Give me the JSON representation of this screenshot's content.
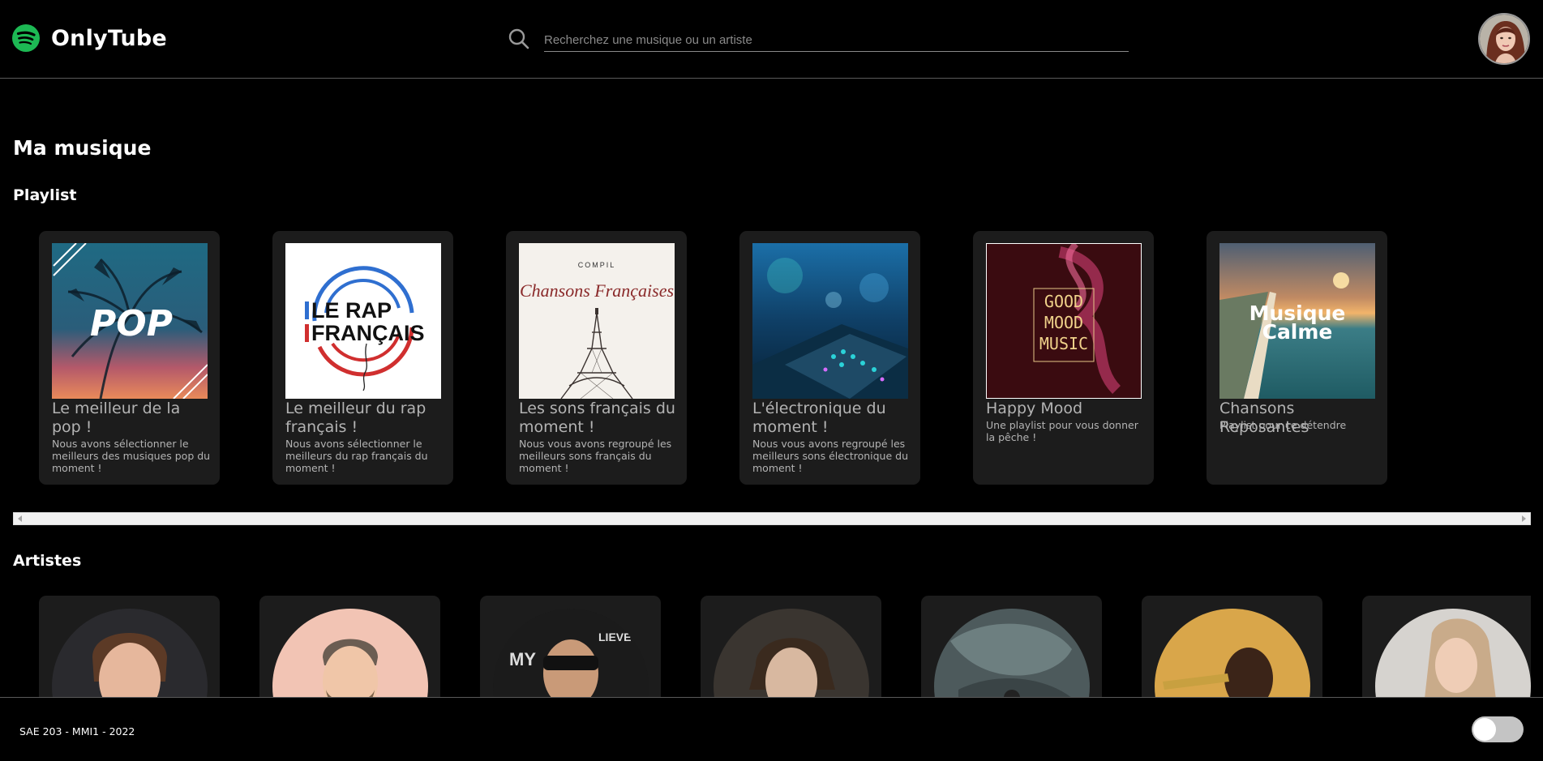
{
  "app": {
    "name": "OnlyTube",
    "brand_color": "#1DB954"
  },
  "search": {
    "placeholder": "Recherchez une musique ou un artiste",
    "value": ""
  },
  "icons": {
    "logo": "spotify-logo-icon",
    "search": "search-icon",
    "avatar": "user-avatar"
  },
  "main": {
    "title": "Ma musique",
    "playlist_section": "Playlist",
    "artists_section": "Artistes"
  },
  "playlists": [
    {
      "title": "Le meilleur de la pop !",
      "description": "Nous avons sélectionner le meilleurs des musiques pop du moment !",
      "cover_text": "POP",
      "cover": "pop"
    },
    {
      "title": "Le meilleur du rap français !",
      "description": "Nous avons sélectionner le meilleurs du rap français du moment !",
      "cover_text": "LE RAP FRANÇAIS",
      "cover": "rap"
    },
    {
      "title": "Les sons français du moment !",
      "description": "Nous vous avons regroupé les meilleurs sons français du moment !",
      "cover_text": "COMPIL Chansons Françaises",
      "cover": "chansons"
    },
    {
      "title": "L'électronique du moment !",
      "description": "Nous vous avons regroupé les meilleurs sons électronique du moment !",
      "cover_text": "",
      "cover": "electro"
    },
    {
      "title": "Happy Mood",
      "description": "Une playlist pour vous donner la pêche !",
      "cover_text": "GOOD MOOD MUSIC",
      "cover": "happy"
    },
    {
      "title": "Chansons Reposantes",
      "description": "Playlist pour ce détendre",
      "cover_text": "Musique Calme",
      "cover": "calme"
    }
  ],
  "artists_count_visible": 7,
  "footer": {
    "text": "SAE 203 - MMI1 - 2022"
  },
  "theme_toggle": {
    "state": "off"
  }
}
